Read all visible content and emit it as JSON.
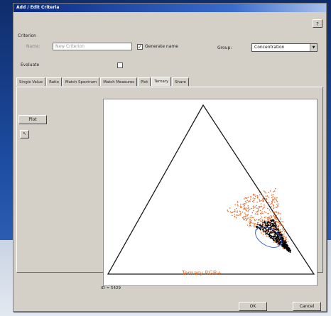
{
  "window": {
    "title": "Add / Edit Criteria"
  },
  "help": {
    "icon": "help-icon",
    "label": "?"
  },
  "criterion": {
    "section_label": "Criterion",
    "name_label": "Name:",
    "name_value": "New Criterion",
    "generate_name_label": "Generate name",
    "generate_name_checked": true,
    "group_label": "Group:",
    "group_value": "Concentration",
    "evaluate_label": "Evaluate",
    "evaluate_checked": false
  },
  "tabs": [
    {
      "label": "Single Value"
    },
    {
      "label": "Ratio"
    },
    {
      "label": "Match Spectrum"
    },
    {
      "label": "Match Measures"
    },
    {
      "label": "Plot"
    },
    {
      "label": "Ternary"
    },
    {
      "label": "Share"
    }
  ],
  "active_tab": "Ternary",
  "side": {
    "plot_button": "Plot",
    "small_button_icon": "cursor-icon"
  },
  "plot": {
    "axis_label": "Ternary RGB+",
    "status_text": "ID = 5429",
    "colors": {
      "outline": "#1a1a1a",
      "points": "#e07030",
      "core": "#000000",
      "contour": "#3355cc",
      "label": "#e07030"
    }
  },
  "footer": {
    "ok": "OK",
    "cancel": "Cancel"
  }
}
